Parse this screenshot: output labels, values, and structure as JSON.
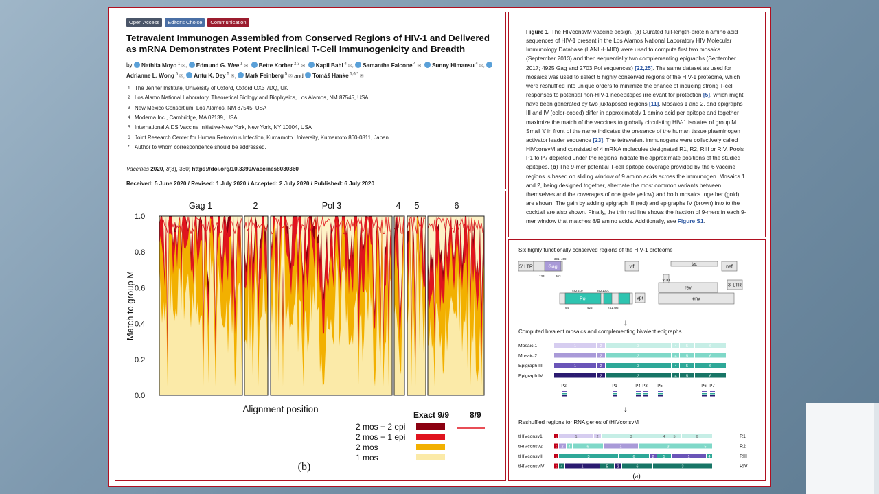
{
  "badges": [
    "Open Access",
    "Editor's Choice",
    "Communication"
  ],
  "paper": {
    "title": "Tetravalent Immunogen Assembled from Conserved Regions of HIV-1 and Delivered as mRNA Demonstrates Potent Preclinical T-Cell Immunogenicity and Breadth",
    "by": "by",
    "authors": [
      {
        "name": "Nathifa Moyo",
        "sup": "1"
      },
      {
        "name": "Edmund G. Wee",
        "sup": "1"
      },
      {
        "name": "Bette Korber",
        "sup": "2,3"
      },
      {
        "name": "Kapil Bahl",
        "sup": "4"
      },
      {
        "name": "Samantha Falcone",
        "sup": "4"
      },
      {
        "name": "Sunny Himansu",
        "sup": "4"
      },
      {
        "name": "Adrianne L. Wong",
        "sup": "5"
      },
      {
        "name": "Antu K. Dey",
        "sup": "5"
      },
      {
        "name": "Mark Feinberg",
        "sup": "5"
      },
      {
        "name": "Tomáš Hanke",
        "sup": "1,6,*"
      }
    ],
    "and": "and",
    "affiliations": [
      {
        "n": "1",
        "text": "The Jenner Institute, University of Oxford, Oxford OX3 7DQ, UK"
      },
      {
        "n": "2",
        "text": "Los Alamo National Laboratory, Theoretical Biology and Biophysics, Los Alamos, NM 87545, USA"
      },
      {
        "n": "3",
        "text": "New Mexico Consortium, Los Alamos, NM 87545, USA"
      },
      {
        "n": "4",
        "text": "Moderna Inc., Cambridge, MA 02139, USA"
      },
      {
        "n": "5",
        "text": "International AIDS Vaccine Initiative-New York, New York, NY 10004, USA"
      },
      {
        "n": "6",
        "text": "Joint Research Center for Human Retrovirus Infection, Kumamoto University, Kumamoto 860-0811, Japan"
      },
      {
        "n": "*",
        "text": "Author to whom correspondence should be addressed."
      }
    ],
    "citation_journal": "Vaccines",
    "citation_year": "2020",
    "citation_vol": "8",
    "citation_rest": "(3), 360; ",
    "doi": "https://doi.org/10.3390/vaccines8030360",
    "received": "Received: 5 June 2020 / Revised: 1 July 2020 / Accepted: 2 July 2020 / Published: 6 July 2020"
  },
  "caption": {
    "label": "Figure 1.",
    "text_a": " The HIVconsvM vaccine design. (",
    "a": "a",
    "text_b": ") Curated full-length-protein amino acid sequences of HIV-1 present in the Los Alamos National Laboratory HIV Molecular Immunology Database (LANL-HMID) were used to compute first two mosaics (September 2013) and then sequentially two complementing epigraphs (September 2017; 4925 Gag and 2703 Pol sequences) ",
    "ref1": "[22,25]",
    "text_c": ". The same dataset as used for mosaics was used to select 6 highly conserved regions of the HIV-1 proteome, which were reshuffled into unique orders to minimize the chance of inducing strong T-cell responses to potential non-HIV-1 neoepitopes irrelevant for protection ",
    "ref2": "[5]",
    "text_d": ", which might have been generated by two juxtaposed regions ",
    "ref3": "[11]",
    "text_e": ". Mosaics 1 and 2, and epigraphs III and IV (color-coded) differ in approximately 1 amino acid per epitope and together maximize the match of the vaccines to globally circulating HIV-1 isolates of group M. Small ‘t’ in front of the name indicates the presence of the human tissue plasminogen activator leader sequence ",
    "ref4": "[23]",
    "text_f": ". The tetravalent immunogens were collectively called HIVconsvM and consisted of 4 mRNA molecules designated R1, R2, RIII or RIV. Pools P1 to P7 depicted under the regions indicate the approximate positions of the studied epitopes. (",
    "b": "b",
    "text_g": ") The 9-mer potential T-cell epitope coverage provided by the 6 vaccine regions is based on sliding window of 9 amino acids across the immunogen. Mosaics 1 and 2, being designed together, alternate the most common variants between themselves and the coverages of one (pale yellow) and both mosaics together (gold) are shown. The gain by adding epigraph III (red) and epigraphs IV (brown) into to the cocktail are also shown. Finally, the thin red line shows the fraction of 9-mers in each 9-mer window that matches 8/9 amino acids. Additionally, see ",
    "ref5": "Figure S1",
    "text_h": "."
  },
  "chart_data": {
    "type": "area",
    "panel_label": "(b)",
    "xlabel": "Alignment position",
    "ylabel": "Match to group M",
    "ylim": [
      0,
      1
    ],
    "yticks": [
      "0.0",
      "0.2",
      "0.4",
      "0.6",
      "0.8",
      "1.0"
    ],
    "regions": [
      "Gag 1",
      "2",
      "Pol 3",
      "4",
      "5",
      "6"
    ],
    "legend_headers": [
      "Exact 9/9",
      "8/9"
    ],
    "legend": [
      {
        "label": "2 mos + 2 epi",
        "color": "#8b0010"
      },
      {
        "label": "2 mos + 1 epi",
        "color": "#e0141e"
      },
      {
        "label": "2 mos",
        "color": "#f2b000"
      },
      {
        "label": "1 mos",
        "color": "#fbeaa8"
      }
    ],
    "series_colors": {
      "8/9": "#e0141e"
    }
  },
  "diagram": {
    "panel_label": "(a)",
    "heading1": "Six highly functionally conserved regions of the HIV-1 proteome",
    "genome": {
      "ltr5": "5' LTR",
      "ltr3": "3' LTR",
      "gag": "Gag",
      "pol": "Pol",
      "vif": "vif",
      "tat": "tat",
      "nef": "nef",
      "vpu": "vpu",
      "rev": "rev",
      "vpr": "vpr",
      "env": "env",
      "gag_ticks": [
        "391",
        "459",
        "133",
        "363"
      ],
      "pol_ticks": [
        "482",
        "510",
        "852",
        "1001",
        "94",
        "426",
        "741",
        "796"
      ]
    },
    "arrow": "↓",
    "heading2": "Computed bivalent mosaics and complementing bivalent epigraphs",
    "mosaic_rows": [
      {
        "label": "Mosaic 1",
        "color": "#d6cdf0",
        "color2": "#c6eee6"
      },
      {
        "label": "Mosaic 2",
        "color": "#a99ad8",
        "color2": "#7fd8c8"
      },
      {
        "label": "Epigraph III",
        "color": "#6a55b8",
        "color2": "#2ea898"
      },
      {
        "label": "Epigraph IV",
        "color": "#2a1a70",
        "color2": "#177566"
      }
    ],
    "segment_nums": [
      "1",
      "2",
      "3",
      "4",
      "5",
      "6"
    ],
    "pools": [
      "P2",
      "P1",
      "P4",
      "P3",
      "P5",
      "P6",
      "P7"
    ],
    "heading3": "Reshuffled regions for RNA genes of tHIVconsvM",
    "genes": [
      {
        "label": "tHIVconsv1",
        "code": "R1",
        "order": [
          "1",
          "2",
          "3",
          "4",
          "5",
          "6"
        ]
      },
      {
        "label": "tHIVconsv2",
        "code": "R2",
        "order": [
          "2",
          "4",
          "6",
          "1",
          "3",
          "5"
        ]
      },
      {
        "label": "tHIVconsvIII",
        "code": "RIII",
        "order": [
          "3",
          "6",
          "2",
          "5",
          "1",
          "4"
        ]
      },
      {
        "label": "tHIVconsvIV",
        "code": "RIV",
        "order": [
          "4",
          "1",
          "5",
          "2",
          "6",
          "3"
        ]
      }
    ]
  }
}
